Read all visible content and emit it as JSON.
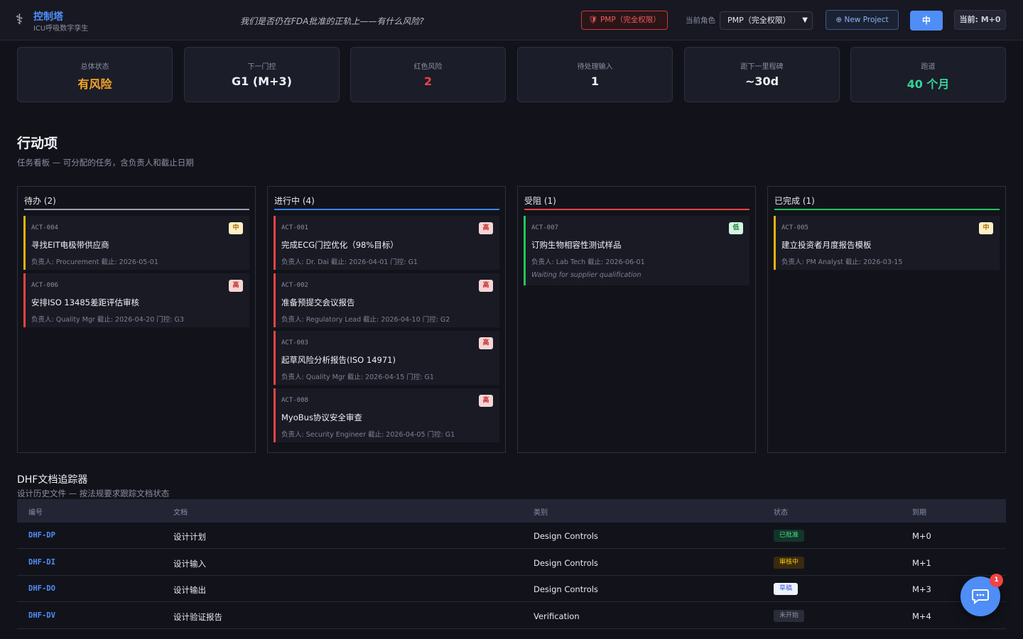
{
  "header": {
    "logo_icon": "caduceus-icon",
    "title": "控制塔",
    "subtitle": "ICU呼吸数字孪生",
    "tagline": "我们是否仍在FDA批准的正轨上——有什么风险?",
    "role_badge": "PMP（完全权限）",
    "role_label": "当前角色",
    "role_select_value": "PMP（完全权限）",
    "new_project": "⊕ New Project",
    "lang": "中",
    "current_month": "当前: M+0"
  },
  "kpis": [
    {
      "label": "总体状态",
      "value": "有风险",
      "color": "#f5a524"
    },
    {
      "label": "下一门控",
      "value": "G1 (M+3)",
      "color": "#f0f2f6"
    },
    {
      "label": "红色风险",
      "value": "2",
      "color": "#ef4444"
    },
    {
      "label": "待处理输入",
      "value": "1",
      "color": "#f0f2f6"
    },
    {
      "label": "距下一里程碑",
      "value": "~30d",
      "color": "#f0f2f6"
    },
    {
      "label": "跑道",
      "value": "40 个月",
      "color": "#34d399"
    }
  ],
  "actions": {
    "title": "行动项",
    "subtitle": "任务看板 — 可分配的任务，含负责人和截止日期",
    "columns": [
      {
        "name": "待办 (2)",
        "color": "#9aa0ae",
        "cards": [
          {
            "id": "ACT-004",
            "title": "寻找EIT电极带供应商",
            "meta": "负责人: Procurement   截止: 2026-05-01",
            "priority": "中",
            "border": "#eab308"
          },
          {
            "id": "ACT-006",
            "title": "安排ISO 13485差距评估审核",
            "meta": "负责人: Quality Mgr   截止: 2026-04-20   门控: G3",
            "priority": "高",
            "border": "#ef4444"
          }
        ]
      },
      {
        "name": "进行中 (4)",
        "color": "#3b82f6",
        "cards": [
          {
            "id": "ACT-001",
            "title": "完成ECG门控优化（98%目标）",
            "meta": "负责人: Dr. Dai   截止: 2026-04-01   门控: G1",
            "priority": "高",
            "border": "#ef4444"
          },
          {
            "id": "ACT-002",
            "title": "准备预提交会议报告",
            "meta": "负责人: Regulatory Lead   截止: 2026-04-10   门控: G2",
            "priority": "高",
            "border": "#ef4444"
          },
          {
            "id": "ACT-003",
            "title": "起草风险分析报告(ISO 14971)",
            "meta": "负责人: Quality Mgr   截止: 2026-04-15   门控: G1",
            "priority": "高",
            "border": "#ef4444"
          },
          {
            "id": "ACT-008",
            "title": "MyoBus协议安全审查",
            "meta": "负责人: Security Engineer   截止: 2026-04-05   门控: G1",
            "priority": "高",
            "border": "#ef4444"
          }
        ]
      },
      {
        "name": "受阻 (1)",
        "color": "#ef4444",
        "cards": [
          {
            "id": "ACT-007",
            "title": "订购生物相容性测试样品",
            "meta": "负责人: Lab Tech   截止: 2026-06-01",
            "note": "Waiting for supplier qualification",
            "priority": "低",
            "border": "#22c55e"
          }
        ]
      },
      {
        "name": "已完成 (1)",
        "color": "#22c55e",
        "cards": [
          {
            "id": "ACT-005",
            "title": "建立投资者月度报告模板",
            "meta": "负责人: PM Analyst   截止: 2026-03-15",
            "priority": "中",
            "border": "#eab308"
          }
        ]
      }
    ]
  },
  "dhf": {
    "title": "DHF文档追踪器",
    "subtitle": "设计历史文件 — 按法规要求跟踪文档状态",
    "headers": [
      "编号",
      "文档",
      "类别",
      "状态",
      "到期"
    ],
    "rows": [
      {
        "id": "DHF-DP",
        "doc": "设计计划",
        "category": "Design Controls",
        "status": "已批准",
        "status_kind": "approved",
        "due": "M+0"
      },
      {
        "id": "DHF-DI",
        "doc": "设计输入",
        "category": "Design Controls",
        "status": "审核中",
        "status_kind": "review",
        "due": "M+1"
      },
      {
        "id": "DHF-DO",
        "doc": "设计输出",
        "category": "Design Controls",
        "status": "草稿",
        "status_kind": "draft",
        "due": "M+3"
      },
      {
        "id": "DHF-DV",
        "doc": "设计验证报告",
        "category": "Verification",
        "status": "未开始",
        "status_kind": "none",
        "due": "M+4"
      }
    ]
  },
  "chat": {
    "icon": "chat-bubble-icon",
    "badge": "1"
  }
}
